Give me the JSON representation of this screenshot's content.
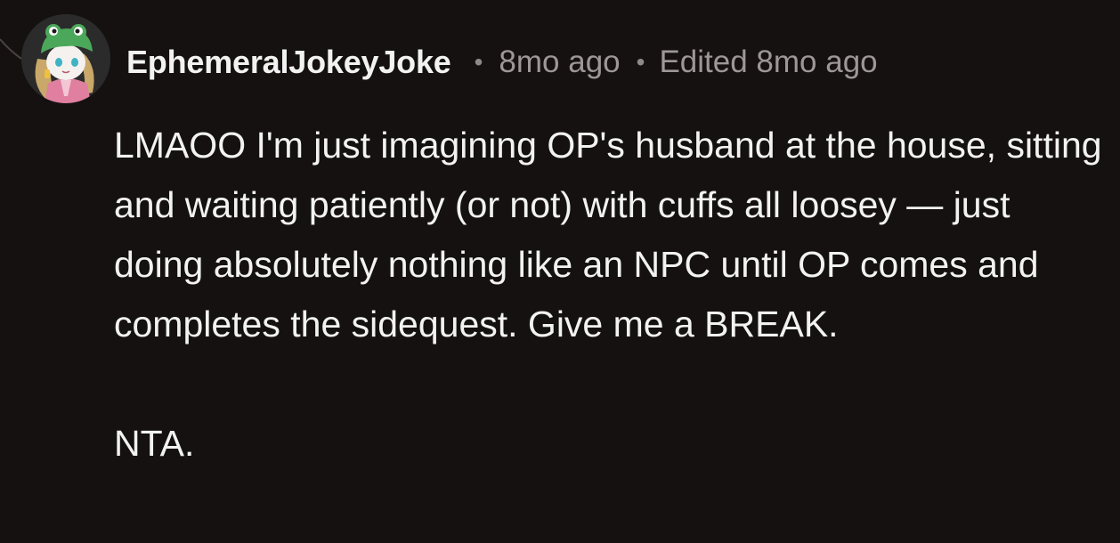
{
  "comment": {
    "username": "EphemeralJokeyJoke",
    "timestamp": "8mo ago",
    "edited": "Edited 8mo ago",
    "separator": "•",
    "avatar_icon": "frog-hat-character-avatar",
    "paragraphs": [
      "LMAOO I'm just imagining OP's husband at the house, sitting and waiting patiently (or not) with cuffs all loosey — just doing absolutely nothing like an NPC until OP comes and completes the sidequest. Give me a BREAK.",
      "NTA."
    ]
  },
  "colors": {
    "background": "#151110",
    "text": "#f2f2f2",
    "meta": "#9d9896"
  }
}
